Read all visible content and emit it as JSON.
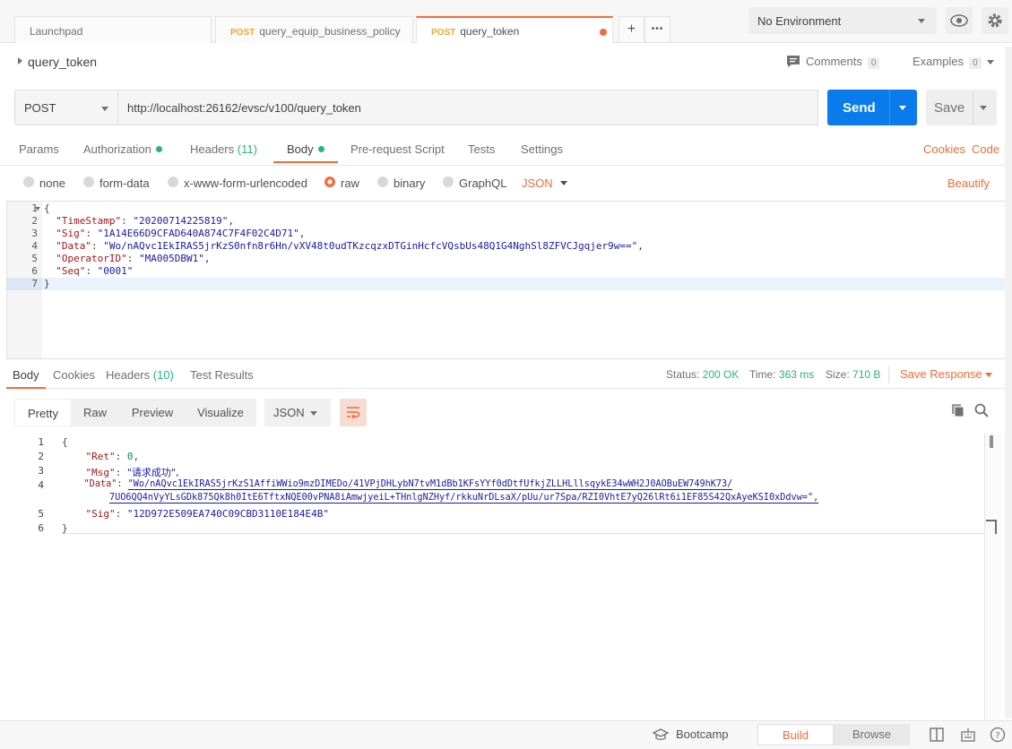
{
  "tabs": [
    {
      "method": "",
      "label": "Launchpad"
    },
    {
      "method": "POST",
      "label": "query_equip_business_policy"
    },
    {
      "method": "POST",
      "label": "query_token"
    }
  ],
  "tab_actions": {
    "add": "+",
    "more": "•••"
  },
  "environment": {
    "selected": "No Environment"
  },
  "request": {
    "name": "query_token",
    "comments_label": "Comments",
    "comments_count": "0",
    "examples_label": "Examples",
    "examples_count": "0",
    "method": "POST",
    "url": "http://localhost:26162/evsc/v100/query_token",
    "send_label": "Send",
    "save_label": "Save"
  },
  "request_tabs": [
    {
      "label": "Params",
      "dot": false
    },
    {
      "label": "Authorization",
      "dot": true
    },
    {
      "label": "Headers",
      "count": "(11)",
      "dot": false
    },
    {
      "label": "Body",
      "dot": true
    },
    {
      "label": "Pre-request Script",
      "dot": false
    },
    {
      "label": "Tests",
      "dot": false
    },
    {
      "label": "Settings",
      "dot": false
    }
  ],
  "request_links": {
    "cookies": "Cookies",
    "code": "Code",
    "beautify": "Beautify"
  },
  "body_types": [
    "none",
    "form-data",
    "x-www-form-urlencoded",
    "raw",
    "binary",
    "GraphQL"
  ],
  "body_format": "JSON",
  "request_body_lines": [
    {
      "n": "1",
      "text": "{"
    },
    {
      "n": "2",
      "key": "\"TimeStamp\"",
      "val": "\"20200714225819\","
    },
    {
      "n": "3",
      "key": "\"Sig\"",
      "val": "\"1A14E66D9CFAD640A874C7F4F02C4D71\","
    },
    {
      "n": "4",
      "key": "\"Data\"",
      "val": "\"Wo/nAQvc1EkIRAS5jrKzS0nfn8r6Hn/vXV48t0udTKzcqzxDTGinHcfcVQsbUs48Q1G4NghSl8ZFVCJgqjer9w==\","
    },
    {
      "n": "5",
      "key": "\"OperatorID\"",
      "val": "\"MA005DBW1\","
    },
    {
      "n": "6",
      "key": "\"Seq\"",
      "val": "\"0001\""
    },
    {
      "n": "7",
      "text": "}"
    }
  ],
  "response_tabs": [
    {
      "label": "Body"
    },
    {
      "label": "Cookies"
    },
    {
      "label": "Headers",
      "count": "(10)"
    },
    {
      "label": "Test Results"
    }
  ],
  "response_status": {
    "status_label": "Status:",
    "status_value": "200 OK",
    "time_label": "Time:",
    "time_value": "363 ms",
    "size_label": "Size:",
    "size_value": "710 B",
    "save_response": "Save Response"
  },
  "response_views": [
    "Pretty",
    "Raw",
    "Preview",
    "Visualize"
  ],
  "response_format": "JSON",
  "response_body_lines": [
    {
      "n": "1",
      "text": "{"
    },
    {
      "n": "2",
      "key": "\"Ret\"",
      "num": "0",
      "tail": ","
    },
    {
      "n": "3",
      "key": "\"Msg\"",
      "val": "\"请求成功\","
    },
    {
      "n": "4",
      "key": "\"Data\"",
      "val": "\"Wo/nAQvc1EkIRAS5jrKzS1AffiWWio9mzDIMEDo/41VPjDHLybN7tvM1dBb1KFsYYf0dDtfUfkjZLLHLllsqykE34wWH2J0AOBuEW749hK73/"
    },
    {
      "n": "",
      "val": "7UO6QQ4nVyYLsGDk875Qk8h0ItE6TftxNQE00vPNA8iAmwjyeiL+THnlgNZHyf/rkkuNrDLsaX/pUu/ur7Spa/RZI0VhtE7yQ26lRt6i1EF85S42QxAyeKSI0xDdvw=\","
    },
    {
      "n": "5",
      "key": "\"Sig\"",
      "val": "\"12D972E509EA740C09CBD3110E184E4B\""
    },
    {
      "n": "6",
      "text": "}"
    }
  ],
  "statusbar": {
    "bootcamp": "Bootcamp",
    "build": "Build",
    "browse": "Browse"
  },
  "colors": {
    "accent": "#f26b3a",
    "send": "#097bed",
    "success": "#26b47f"
  }
}
